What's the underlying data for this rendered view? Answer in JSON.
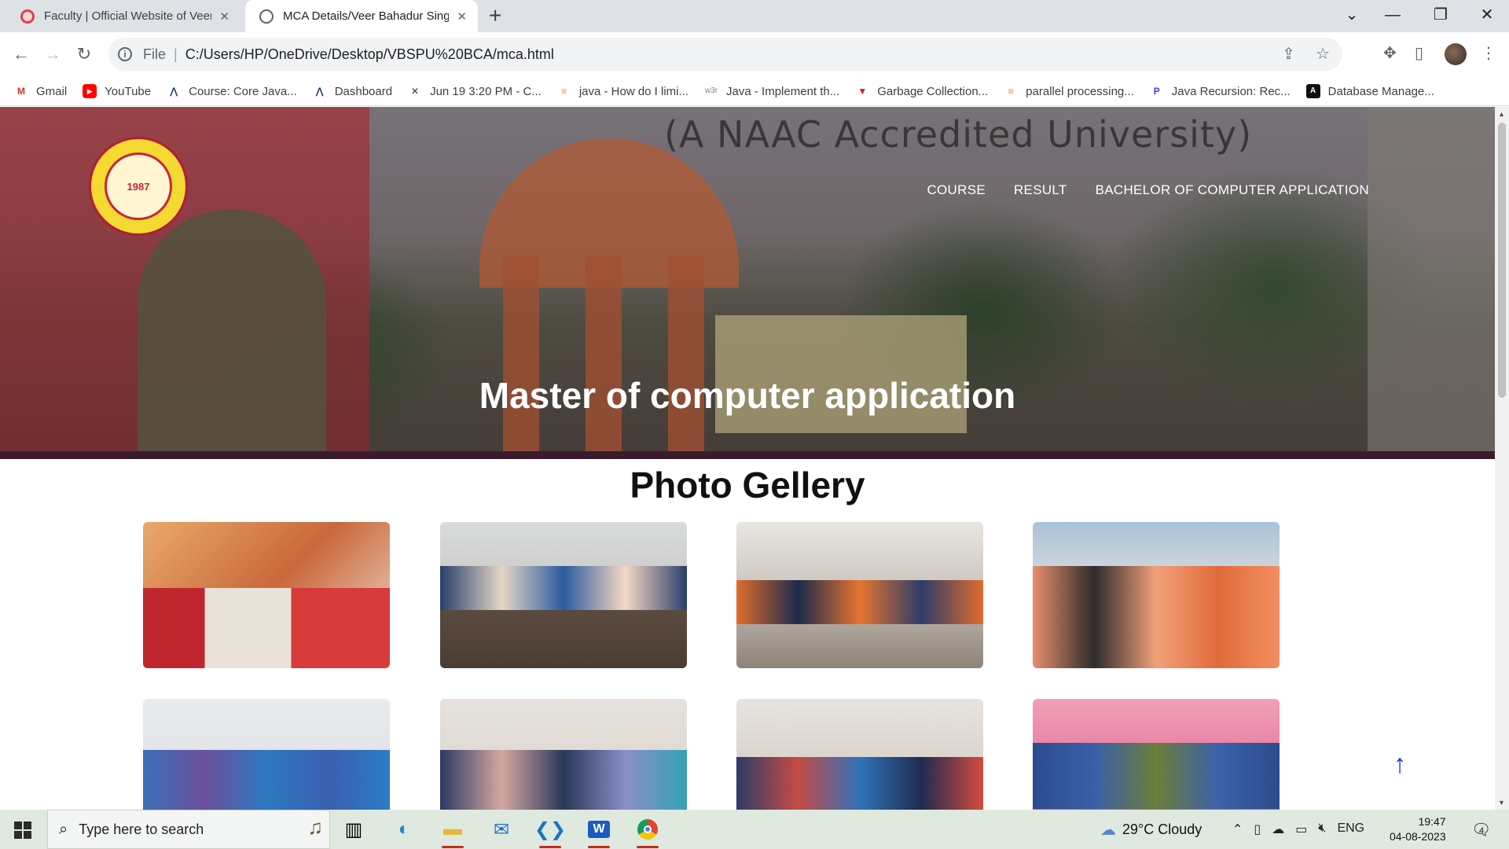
{
  "browser": {
    "tabs": [
      {
        "title": "Faculty | Official Website of Veer",
        "active": false
      },
      {
        "title": "MCA Details/Veer Bahadur Singh",
        "active": true
      }
    ],
    "address": {
      "scheme": "File",
      "url": "C:/Users/HP/OneDrive/Desktop/VBSPU%20BCA/mca.html"
    },
    "bookmarks": [
      {
        "label": "Gmail",
        "icon": "gmail-icon"
      },
      {
        "label": "YouTube",
        "icon": "youtube-icon"
      },
      {
        "label": "Course: Core Java...",
        "icon": "course-icon"
      },
      {
        "label": "Dashboard",
        "icon": "dashboard-icon"
      },
      {
        "label": "Jun 19 3:20 PM - C...",
        "icon": "meeting-icon"
      },
      {
        "label": "java - How do I limi...",
        "icon": "stackoverflow-icon"
      },
      {
        "label": "Java - Implement th...",
        "icon": "w3r-icon"
      },
      {
        "label": "Garbage Collection...",
        "icon": "garbage-icon"
      },
      {
        "label": "parallel processing...",
        "icon": "stackoverflow-icon"
      },
      {
        "label": "Java Recursion: Rec...",
        "icon": "recursion-icon"
      },
      {
        "label": "Database Manage...",
        "icon": "database-icon"
      }
    ]
  },
  "site": {
    "banner_text": "(A NAAC Accredited University)",
    "logo_text": "1987",
    "nav": [
      {
        "label": "COURSE"
      },
      {
        "label": "RESULT"
      },
      {
        "label": "BACHELOR OF COMPUTER APPLICATION"
      }
    ],
    "hero_title": "Master of computer application",
    "gallery_title": "Photo Gellery",
    "back_to_top": "↑"
  },
  "taskbar": {
    "search_placeholder": "Type here to search",
    "weather": "29°C  Cloudy",
    "language": "ENG",
    "time": "19:47",
    "date": "04-08-2023",
    "notifications": "4"
  }
}
